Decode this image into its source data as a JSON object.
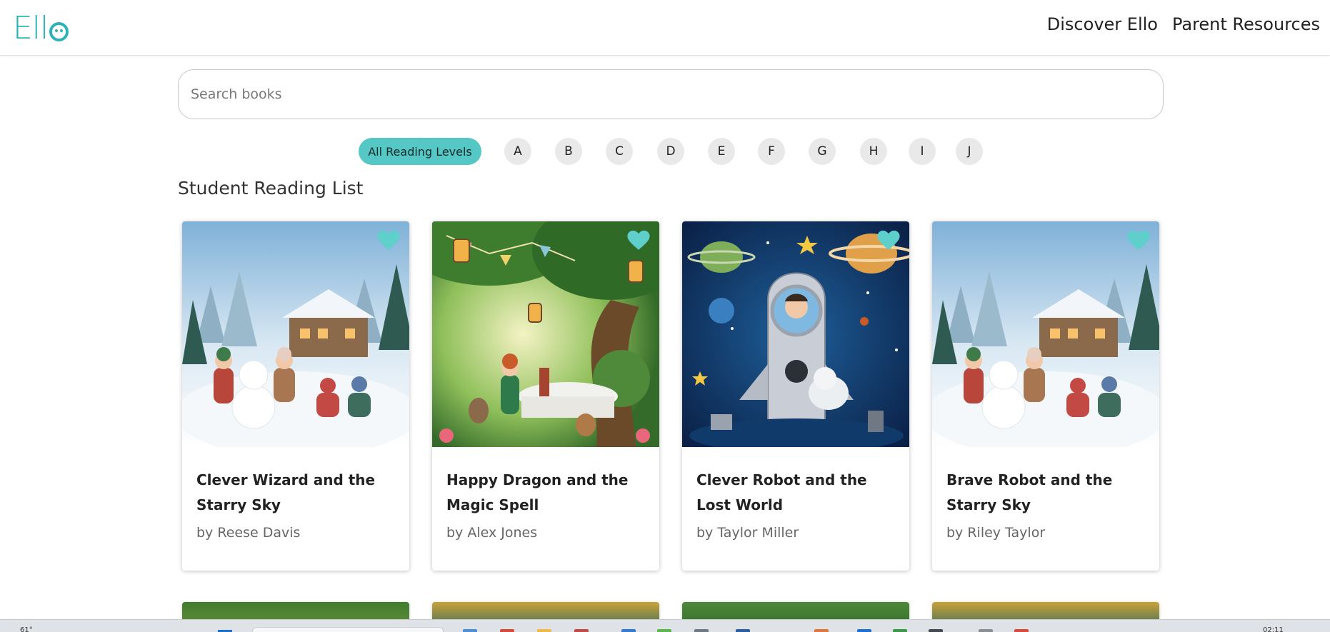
{
  "header": {
    "logo": "Ell",
    "nav": [
      "Discover Ello",
      "Parent Resources"
    ]
  },
  "search": {
    "placeholder": "Search books",
    "value": ""
  },
  "levels": {
    "all_label": "All Reading Levels",
    "letters": [
      "A",
      "B",
      "C",
      "D",
      "E",
      "F",
      "G",
      "H",
      "I",
      "J"
    ],
    "selected": "All Reading Levels"
  },
  "section": {
    "title": "Student Reading List"
  },
  "books": [
    {
      "title": "Clever Wizard and the Starry Sky",
      "author": "by Reese Davis",
      "cover": "winter-scene"
    },
    {
      "title": "Happy Dragon and the Magic Spell",
      "author": "by Alex Jones",
      "cover": "forest-tea-party"
    },
    {
      "title": "Clever Robot and the Lost World",
      "author": "by Taylor Miller",
      "cover": "space-rocket"
    },
    {
      "title": "Brave Robot and the Starry Sky",
      "author": "by Riley Taylor",
      "cover": "winter-scene"
    }
  ],
  "colors": {
    "accent": "#55c7c4",
    "logo": "#2bb3b7",
    "heart": "#5fcfcb"
  },
  "taskbar": {
    "temperature": "61°",
    "time": "02:11"
  }
}
